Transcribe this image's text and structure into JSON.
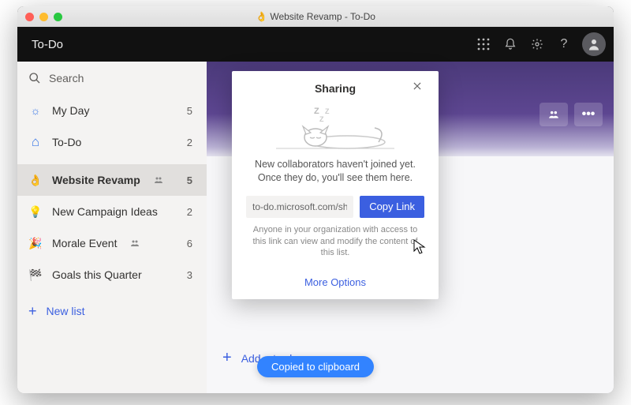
{
  "window": {
    "title": "Website Revamp - To-Do",
    "title_icon": "👌"
  },
  "app": {
    "name": "To-Do"
  },
  "search": {
    "placeholder": "Search"
  },
  "sidebar": {
    "items": [
      {
        "icon": "sun",
        "label": "My Day",
        "count": "5",
        "shared": false,
        "selected": false
      },
      {
        "icon": "home",
        "label": "To-Do",
        "count": "2",
        "shared": false,
        "selected": false
      },
      {
        "icon": "ok",
        "label": "Website Revamp",
        "count": "5",
        "shared": true,
        "selected": true
      },
      {
        "icon": "bulb",
        "label": "New Campaign Ideas",
        "count": "2",
        "shared": false,
        "selected": false
      },
      {
        "icon": "party",
        "label": "Morale Event",
        "count": "6",
        "shared": true,
        "selected": false
      },
      {
        "icon": "flag",
        "label": "Goals this Quarter",
        "count": "3",
        "shared": false,
        "selected": false
      }
    ],
    "new_list": "New list"
  },
  "main": {
    "add_label": "Add a to-do"
  },
  "modal": {
    "title": "Sharing",
    "message": "New collaborators haven't joined yet. Once they do, you'll see them here.",
    "link_value": "to-do.microsoft.com/sharing",
    "copy_label": "Copy Link",
    "fineprint": "Anyone in your organization with access to this link can view and modify the content of this list.",
    "more": "More Options"
  },
  "toast": {
    "text": "Copied to clipboard"
  },
  "icons": {
    "sun": "☼",
    "home": "⌂",
    "ok": "👌",
    "bulb": "💡",
    "party": "🎉",
    "flag": "🏁"
  }
}
